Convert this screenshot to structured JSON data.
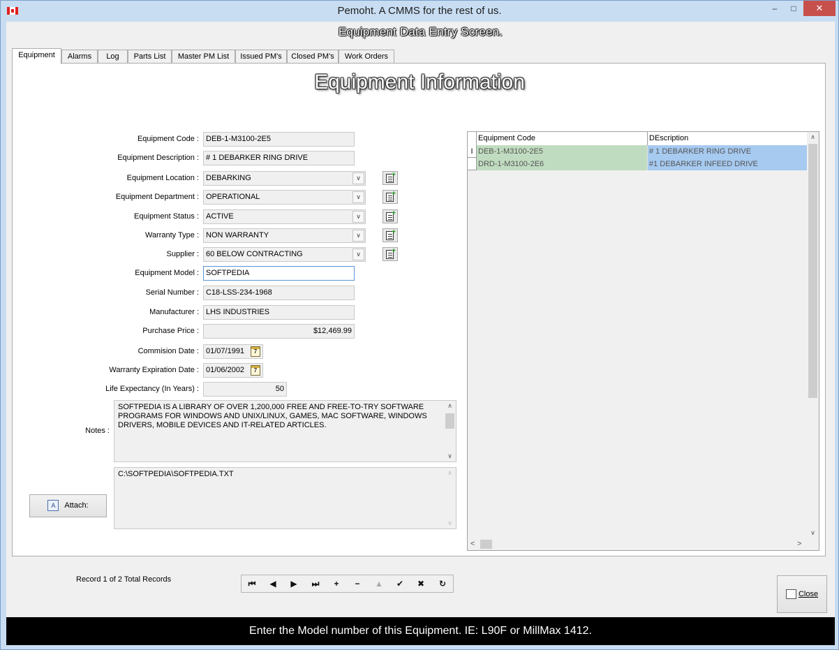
{
  "window": {
    "title": "Pemoht.  A CMMS for the rest of us.",
    "screen_heading": "Equipment Data Entry Screen.",
    "controls": {
      "minimize": "–",
      "maximize": "□",
      "close": "✕"
    }
  },
  "tabs": [
    "Equipment",
    "Alarms",
    "Log",
    "Parts List",
    "Master PM List",
    "Issued PM's",
    "Closed PM's",
    "Work Orders"
  ],
  "panel_title": "Equipment Information",
  "form": {
    "equipment_code": {
      "label": "Equipment Code :",
      "value": "DEB-1-M3100-2E5"
    },
    "equipment_description": {
      "label": "Equipment Description :",
      "value": "# 1 DEBARKER RING DRIVE"
    },
    "equipment_location": {
      "label": "Equipment Location :",
      "value": "DEBARKING"
    },
    "equipment_department": {
      "label": "Equipment Department :",
      "value": "OPERATIONAL"
    },
    "equipment_status": {
      "label": "Equipment Status :",
      "value": "ACTIVE"
    },
    "warranty_type": {
      "label": "Warranty Type :",
      "value": "NON WARRANTY"
    },
    "supplier": {
      "label": "Supplier :",
      "value": "60 BELOW CONTRACTING"
    },
    "equipment_model": {
      "label": "Equipment Model :",
      "value": "SOFTPEDIA"
    },
    "serial_number": {
      "label": "Serial Number :",
      "value": "C18-LSS-234-1968"
    },
    "manufacturer": {
      "label": "Manufacturer :",
      "value": "LHS INDUSTRIES"
    },
    "purchase_price": {
      "label": "Purchase Price :",
      "value": "$12,469.99"
    },
    "commision_date": {
      "label": "Commision Date :",
      "value": "01/07/1991"
    },
    "warranty_expiration_date": {
      "label": "Warranty Expiration Date :",
      "value": "01/06/2002"
    },
    "life_expectancy": {
      "label": "Life Expectancy (In Years) :",
      "value": "50"
    },
    "notes": {
      "label": "Notes :",
      "value": "SOFTPEDIA IS A LIBRARY OF OVER 1,200,000 FREE AND FREE-TO-TRY SOFTWARE PROGRAMS FOR WINDOWS AND UNIX/LINUX, GAMES, MAC SOFTWARE, WINDOWS DRIVERS, MOBILE DEVICES AND IT-RELATED ARTICLES."
    },
    "attachment_path": "C:\\SOFTPEDIA\\SOFTPEDIA.TXT",
    "attach_button": "Attach:",
    "calendar_glyph": "7",
    "dropdown_glyph": "∨"
  },
  "grid": {
    "columns": [
      "Equipment Code",
      "DEscription"
    ],
    "rows": [
      {
        "indicator": "I",
        "code": "DEB-1-M3100-2E5",
        "description": "# 1 DEBARKER RING DRIVE"
      },
      {
        "indicator": "",
        "code": "DRD-1-M3100-2E6",
        "description": "#1 DEBARKER INFEED DRIVE"
      }
    ],
    "scroll_glyphs": {
      "up": "∧",
      "down": "∨",
      "left": "<",
      "right": ">"
    }
  },
  "record_status": "Record 1 of 2 Total Records",
  "navigator": [
    {
      "name": "first-record-button",
      "glyph": "⏮",
      "enabled": true
    },
    {
      "name": "prior-record-button",
      "glyph": "◀",
      "enabled": true
    },
    {
      "name": "next-record-button",
      "glyph": "▶",
      "enabled": true
    },
    {
      "name": "last-record-button",
      "glyph": "⏭",
      "enabled": true
    },
    {
      "name": "insert-record-button",
      "glyph": "+",
      "enabled": true
    },
    {
      "name": "delete-record-button",
      "glyph": "−",
      "enabled": true
    },
    {
      "name": "edit-record-button",
      "glyph": "▲",
      "enabled": false
    },
    {
      "name": "post-record-button",
      "glyph": "✔",
      "enabled": true
    },
    {
      "name": "cancel-edit-button",
      "glyph": "✖",
      "enabled": true
    },
    {
      "name": "refresh-button",
      "glyph": "↻",
      "enabled": true
    }
  ],
  "close_button": "Close",
  "status_message": "Enter the Model number of this Equipment.  IE:  L90F or MillMax 1412.",
  "colors": {
    "grid_code_bg": "#c0dcc0",
    "grid_desc_bg": "#a6caf0",
    "status_bar_bg": "#000000",
    "title_bar_bg": "#c8ddf2"
  }
}
